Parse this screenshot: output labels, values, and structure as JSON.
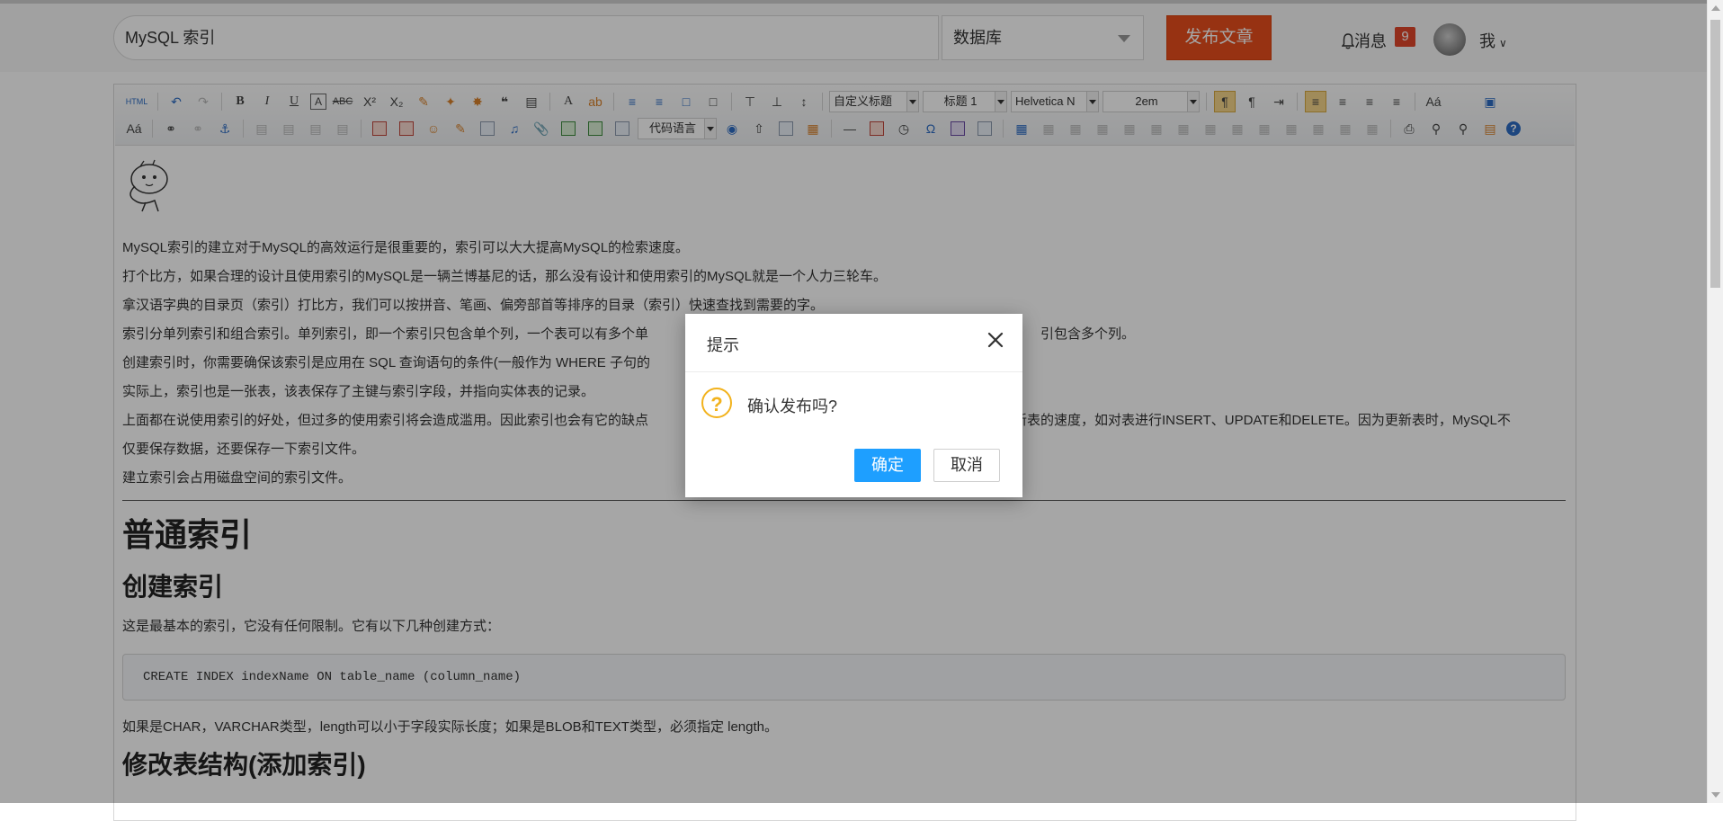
{
  "header": {
    "title_value": "MySQL 索引",
    "category_value": "数据库",
    "publish_label": "发布文章",
    "messages_label": "消息",
    "messages_count": "9",
    "me_label": "我"
  },
  "toolbar": {
    "custom_heading": "自定义标题",
    "heading_level": "标题 1",
    "font_family": "Helvetica N",
    "line_height": "2em",
    "code_language": "代码语言",
    "html_label": "HTML"
  },
  "article": {
    "paragraphs": [
      "MySQL索引的建立对于MySQL的高效运行是很重要的，索引可以大大提高MySQL的检索速度。",
      "打个比方，如果合理的设计且使用索引的MySQL是一辆兰博基尼的话，那么没有设计和使用索引的MySQL就是一个人力三轮车。",
      "拿汉语字典的目录页（索引）打比方，我们可以按拼音、笔画、偏旁部首等排序的目录（索引）快速查找到需要的字。",
      "索引分单列索引和组合索引。单列索引，即一个索引只包含单个列，一个表可以有多个单",
      "创建索引时，你需要确保该索引是应用在 SQL 查询语句的条件(一般作为 WHERE 子句的",
      "实际上，索引也是一张表，该表保存了主键与索引字段，并指向实体表的记录。",
      "上面都在说使用索引的好处，但过多的使用索引将会造成滥用。因此索引也会有它的缺点"
    ],
    "p4_tail": "引包含多个列。",
    "p7_tail": "新表的速度，如对表进行INSERT、UPDATE和DELETE。因为更新表时，MySQL不",
    "p7_line2": "仅要保存数据，还要保存一下索引文件。",
    "p8": "建立索引会占用磁盘空间的索引文件。",
    "h1": "普通索引",
    "h2_create": "创建索引",
    "create_desc": "这是最基本的索引，它没有任何限制。它有以下几种创建方式：",
    "code_create": "CREATE INDEX indexName ON table_name (column_name)",
    "length_note": "如果是CHAR，VARCHAR类型，length可以小于字段实际长度；如果是BLOB和TEXT类型，必须指定 length。",
    "h2_alter": "修改表结构(添加索引)"
  },
  "dialog": {
    "title": "提示",
    "message": "确认发布吗?",
    "ok_label": "确定",
    "cancel_label": "取消",
    "icon": "question-icon"
  },
  "colors": {
    "publish": "#e84d1c",
    "badge": "#e0462a",
    "ok_button": "#1e9fff",
    "warning_icon": "#f2b21c"
  }
}
